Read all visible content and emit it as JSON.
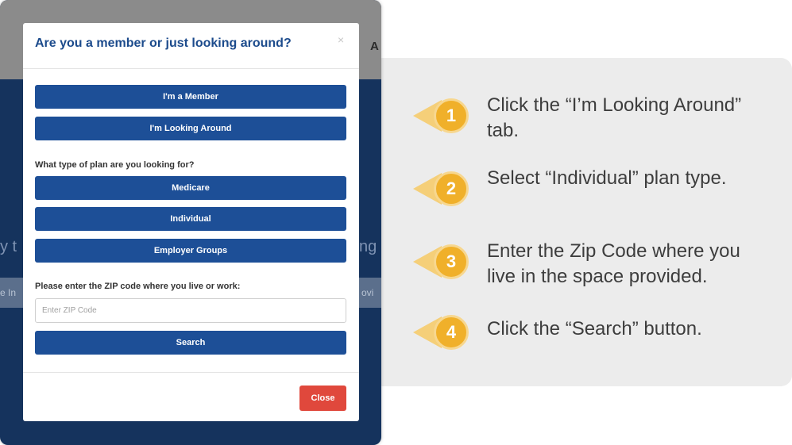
{
  "modal": {
    "title": "Are you a member or just looking around?",
    "close_symbol": "×",
    "member_button": "I'm a Member",
    "looking_button": "I'm Looking Around",
    "plan_question": "What type of plan are you looking for?",
    "plan_options": [
      "Medicare",
      "Individual",
      "Employer Groups"
    ],
    "zip_label": "Please enter the ZIP code where you live or work:",
    "zip_placeholder": "Enter ZIP Code",
    "zip_value": "",
    "search_button": "Search",
    "close_button": "Close"
  },
  "steps": [
    {
      "number": "1",
      "text": "Click the “I’m Looking Around” tab."
    },
    {
      "number": "2",
      "text": "Select “Individual” plan type."
    },
    {
      "number": "3",
      "text": "Enter the Zip Code where you live in the space provided."
    },
    {
      "number": "4",
      "text": "Click the “Search” button."
    }
  ],
  "colors": {
    "primary_button": "#1d4f97",
    "close_button": "#e0483c",
    "badge": "#f0b02a",
    "title": "#1c4b8c"
  }
}
